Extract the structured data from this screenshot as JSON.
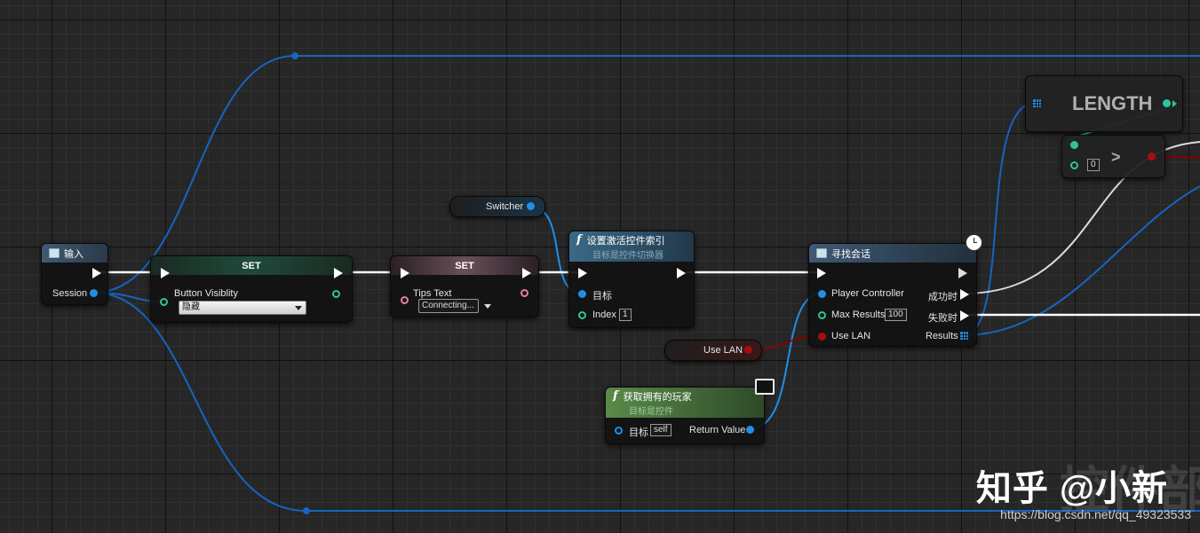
{
  "nodes": {
    "input": {
      "title": "输入",
      "session_label": "Session"
    },
    "set_visibility": {
      "title": "SET",
      "pin_label": "Button Visiblity",
      "dropdown_value": "隐藏"
    },
    "set_tips": {
      "title": "SET",
      "pin_label": "Tips Text",
      "dropdown_value": "Connecting..."
    },
    "switcher": {
      "label": "Switcher"
    },
    "set_active_widget_index": {
      "title": "设置激活控件索引",
      "subtitle": "目标是控件切换器",
      "target_label": "目标",
      "index_label": "Index",
      "index_value": "1"
    },
    "use_lan": {
      "label": "Use LAN"
    },
    "get_owning_player": {
      "title": "获取拥有的玩家",
      "subtitle": "目标是控件",
      "target_label": "目标",
      "target_value": "self",
      "return_label": "Return Value"
    },
    "find_sessions": {
      "title": "寻找会话",
      "player_controller_label": "Player Controller",
      "max_results_label": "Max Results",
      "max_results_value": "100",
      "use_lan_label": "Use LAN",
      "on_success_label": "成功时",
      "on_failure_label": "失败时",
      "results_label": "Results"
    },
    "length": {
      "title": "LENGTH"
    },
    "greater": {
      "op": ">",
      "value": "0"
    }
  },
  "watermark": {
    "text": "知乎 @小新",
    "bg_text": "控件部",
    "url": "https://blog.csdn.net/qq_49323533"
  },
  "colors": {
    "exec_wire": "#ffffff",
    "object_wire": "#1565c0",
    "bool_wire": "#8b0000",
    "int_wire": "#2ec4a0",
    "set_header": "#1f4a3a",
    "set_tips_header": "#6a4f5a",
    "function_header": "#2f5a74",
    "pure_function_header": "#4a6e3a"
  }
}
